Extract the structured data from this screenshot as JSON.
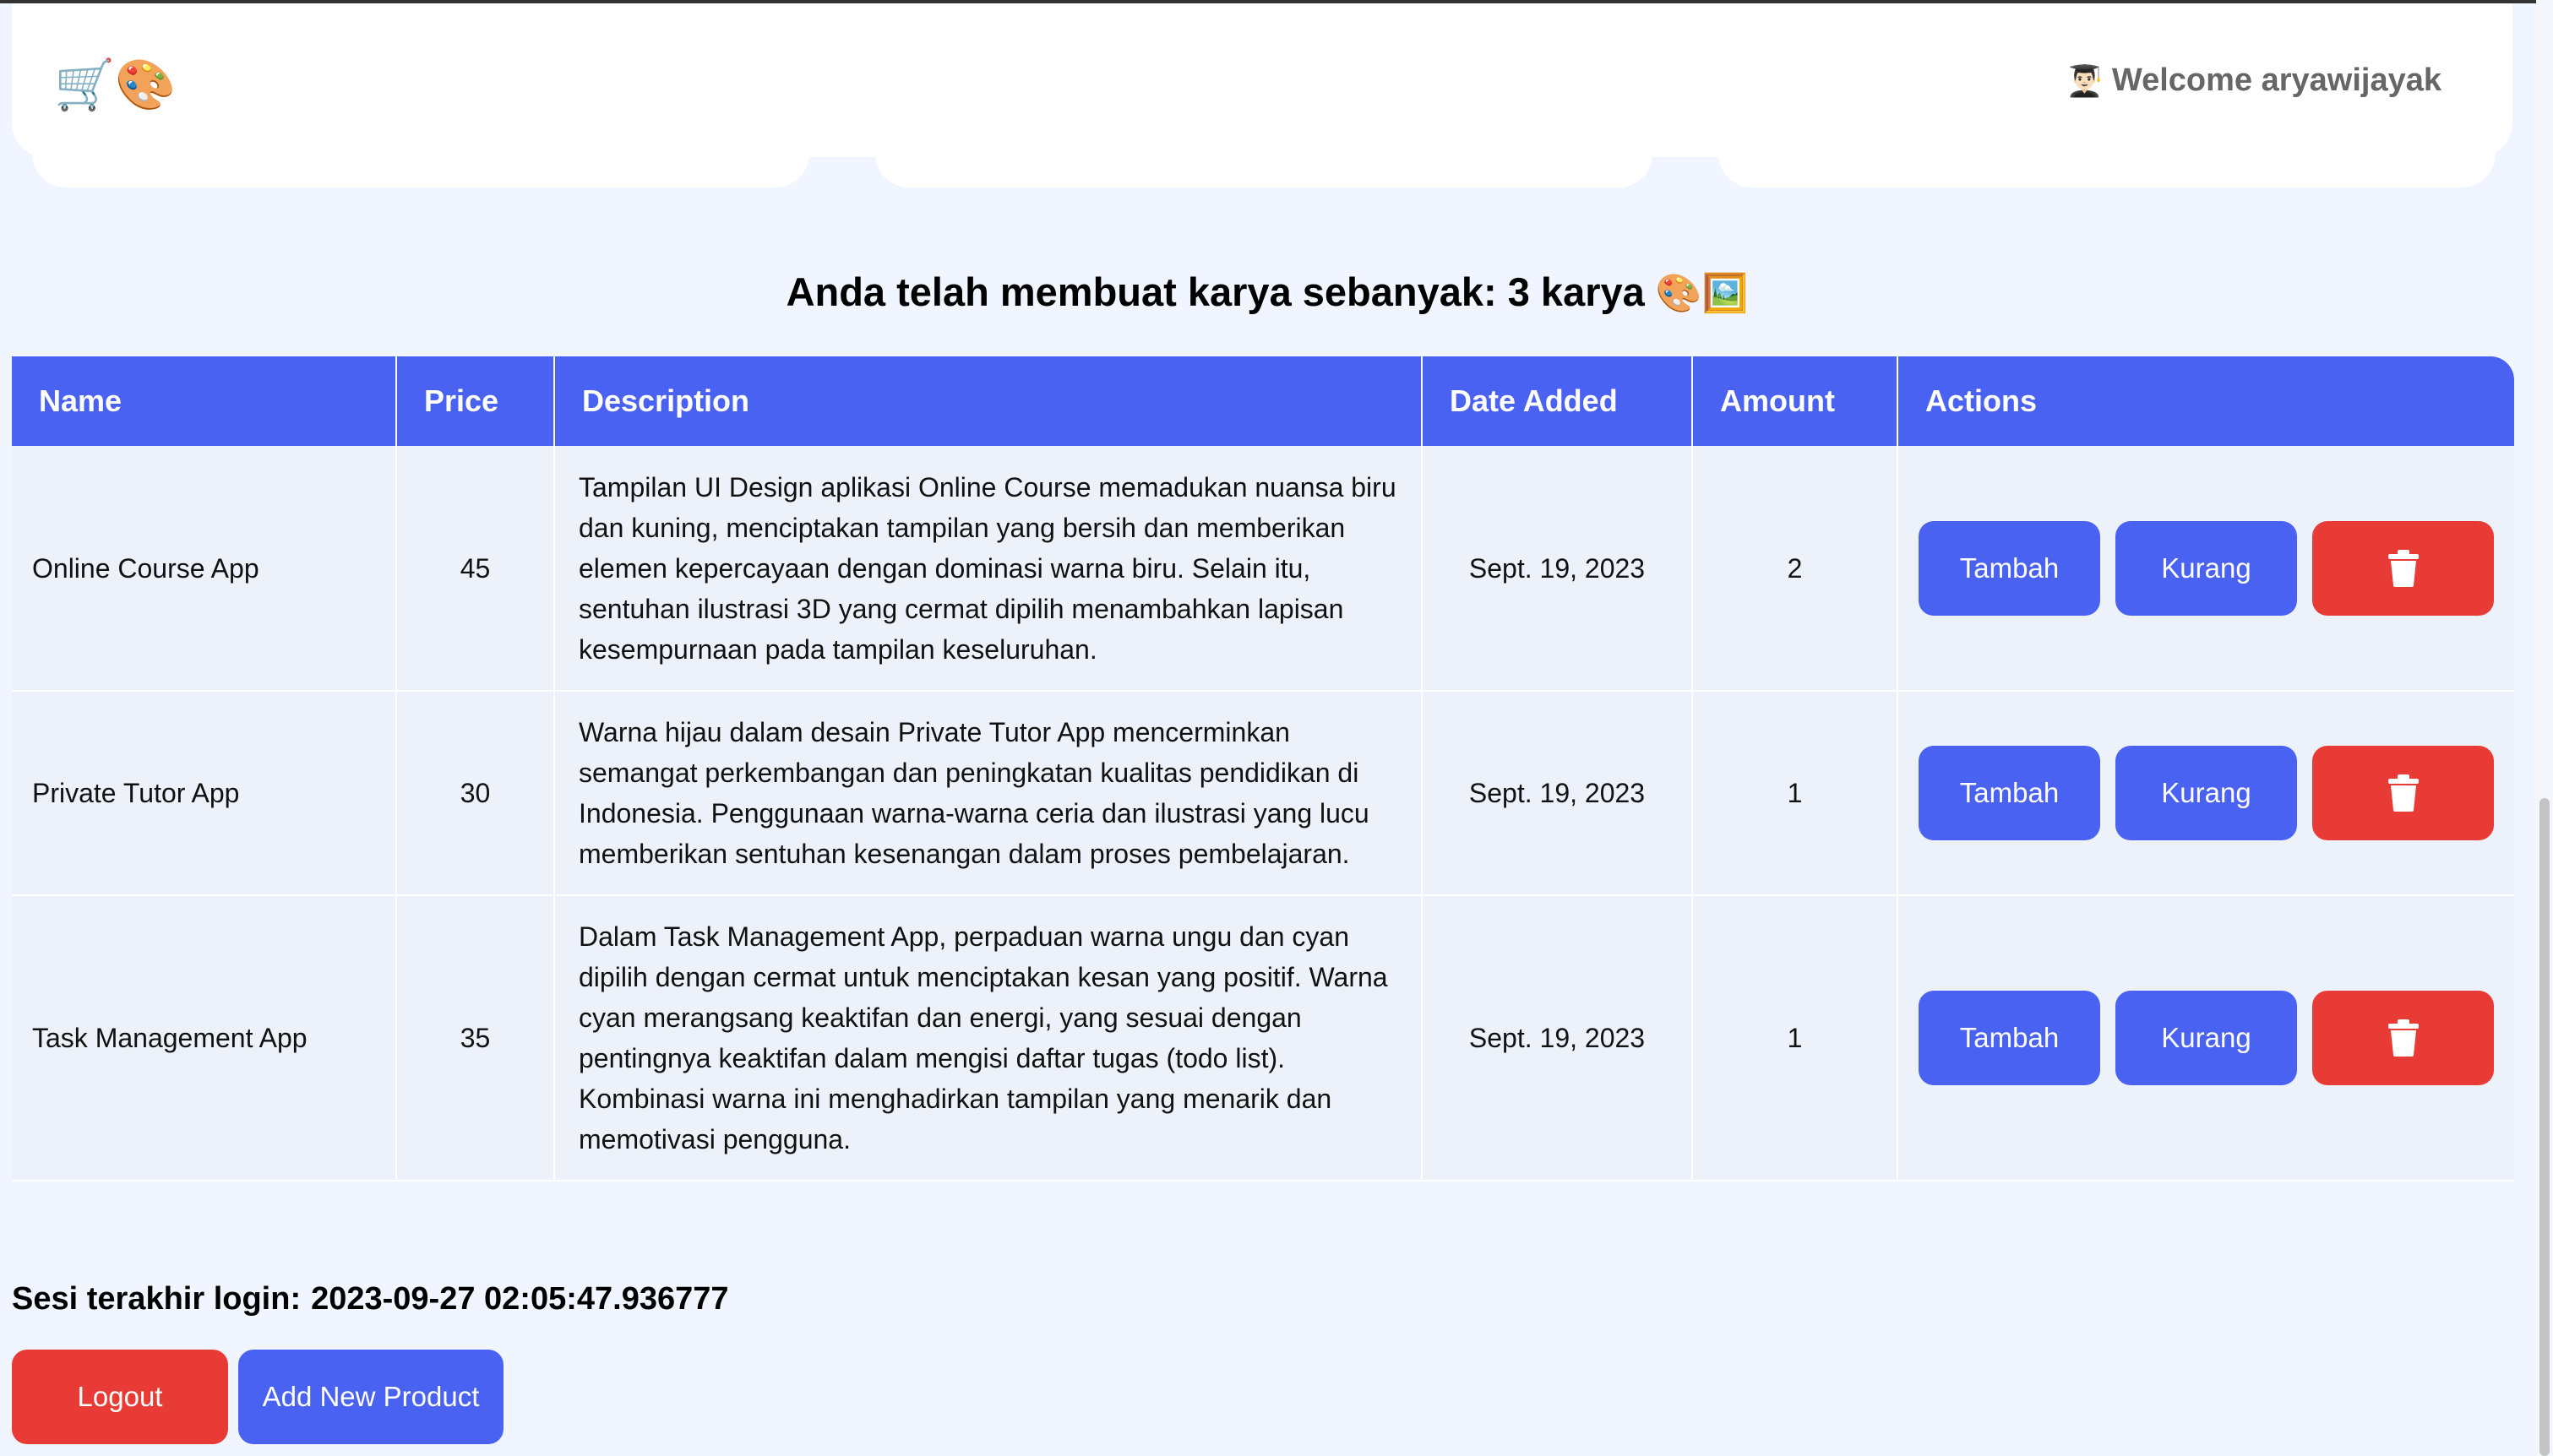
{
  "header": {
    "brand_icons": [
      "🛒",
      "🎨"
    ],
    "welcome_icon": "👨🏻‍🎓",
    "welcome_text": "Welcome aryawijayak"
  },
  "count_heading": {
    "text": "Anda telah membuat karya sebanyak: 3 karya",
    "icons": "🎨🖼️"
  },
  "table": {
    "columns": [
      "Name",
      "Price",
      "Description",
      "Date Added",
      "Amount",
      "Actions"
    ],
    "rows": [
      {
        "name": "Online Course App",
        "price": "45",
        "description": "Tampilan UI Design aplikasi Online Course memadukan nuansa biru dan kuning, menciptakan tampilan yang bersih dan memberikan elemen kepercayaan dengan dominasi warna biru. Selain itu, sentuhan ilustrasi 3D yang cermat dipilih menambahkan lapisan kesempurnaan pada tampilan keseluruhan.",
        "date_added": "Sept. 19, 2023",
        "amount": "2"
      },
      {
        "name": "Private Tutor App",
        "price": "30",
        "description": "Warna hijau dalam desain Private Tutor App mencerminkan semangat perkembangan dan peningkatan kualitas pendidikan di Indonesia. Penggunaan warna-warna ceria dan ilustrasi yang lucu memberikan sentuhan kesenangan dalam proses pembelajaran.",
        "date_added": "Sept. 19, 2023",
        "amount": "1"
      },
      {
        "name": "Task Management App",
        "price": "35",
        "description": "Dalam Task Management App, perpaduan warna ungu dan cyan dipilih dengan cermat untuk menciptakan kesan yang positif. Warna cyan merangsang keaktifan dan energi, yang sesuai dengan pentingnya keaktifan dalam mengisi daftar tugas (todo list). Kombinasi warna ini menghadirkan tampilan yang menarik dan memotivasi pengguna.",
        "date_added": "Sept. 19, 2023",
        "amount": "1"
      }
    ],
    "action_labels": {
      "add": "Tambah",
      "subtract": "Kurang",
      "delete_icon": "trash-icon"
    }
  },
  "session": {
    "label": "Sesi terakhir login:",
    "value": "2023-09-27 02:05:47.936777"
  },
  "footer": {
    "logout_label": "Logout",
    "add_product_label": "Add New Product"
  },
  "colors": {
    "primary": "#4a62f2",
    "danger": "#e93b35",
    "background": "#f0f5ff",
    "row_bg": "#edf1f9"
  }
}
